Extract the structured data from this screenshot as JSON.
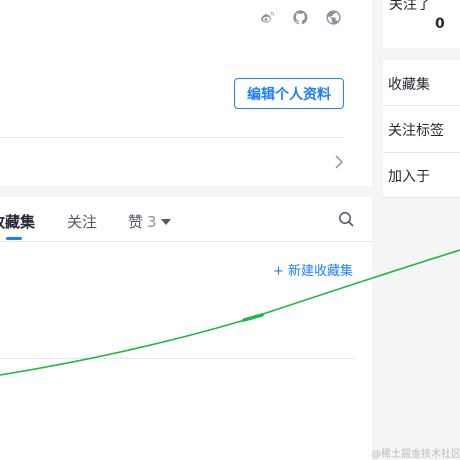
{
  "social_icons": [
    {
      "name": "weibo-icon"
    },
    {
      "name": "github-icon"
    },
    {
      "name": "globe-icon"
    }
  ],
  "profile": {
    "edit_label": "编辑个人资料"
  },
  "tabs": {
    "items": [
      {
        "label": "收藏集",
        "active": true
      },
      {
        "label": "关注",
        "active": false
      },
      {
        "label": "赞",
        "count": "3",
        "active": false
      }
    ]
  },
  "actions": {
    "new_collection": "+ 新建收藏集"
  },
  "sidebar": {
    "follow_label": "关注了",
    "follow_count": "0",
    "items": [
      "收藏集",
      "关注标签",
      "加入于"
    ]
  },
  "watermark": "@稀土掘金技术社区",
  "colors": {
    "accent": "#1e80ff",
    "stroke": "#1cb841"
  }
}
